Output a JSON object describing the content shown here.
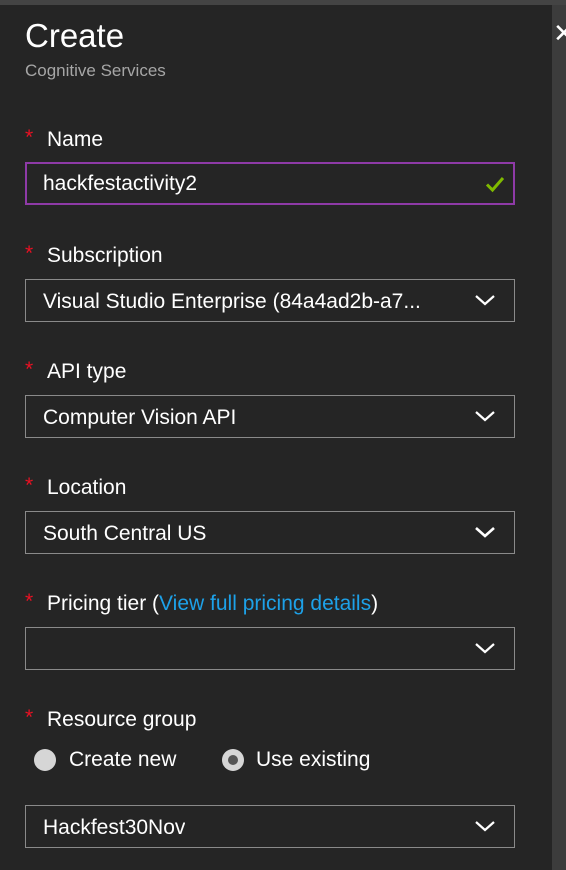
{
  "header": {
    "title": "Create",
    "subtitle": "Cognitive Services",
    "close_glyph": "✕"
  },
  "required_marker": "*",
  "name": {
    "label": "Name",
    "value": "hackfestactivity2",
    "valid": true
  },
  "subscription": {
    "label": "Subscription",
    "value": "Visual Studio Enterprise (84a4ad2b-a7..."
  },
  "api_type": {
    "label": "API type",
    "value": "Computer Vision API"
  },
  "location": {
    "label": "Location",
    "value": "South Central US"
  },
  "pricing_tier": {
    "label": "Pricing tier",
    "paren_open": "(",
    "link_text": "View full pricing details",
    "paren_close": ")",
    "value": ""
  },
  "resource_group": {
    "label": "Resource group",
    "options": {
      "create_new": "Create new",
      "use_existing": "Use existing"
    },
    "selected": "use_existing",
    "value": "Hackfest30Nov"
  },
  "colors": {
    "blade_bg": "#252525",
    "required": "#e81123",
    "link": "#1da1e8",
    "focus_border": "#8e3aa7",
    "valid_check": "#7fba00"
  },
  "icons": {
    "close": "close-icon",
    "dropdown": "chevron-down-icon",
    "valid": "checkmark-icon"
  }
}
